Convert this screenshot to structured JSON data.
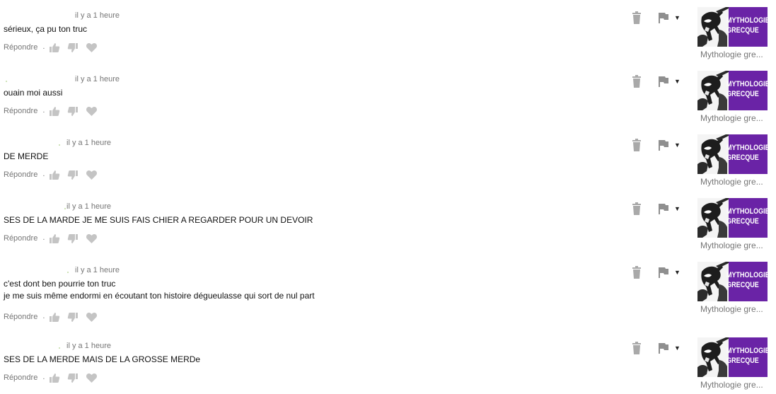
{
  "icons": {
    "like": "thumb-up-icon",
    "dislike": "thumb-down-icon",
    "heart": "heart-icon",
    "delete": "trash-icon",
    "report": "flag-icon",
    "menu": "caret-down-icon"
  },
  "colors": {
    "thumbnail_bg": "#6a23a6",
    "meta_text": "#767676",
    "icon_gray": "#b8b8b8"
  },
  "comments": [
    {
      "timestamp": "il y a 1 heure",
      "lines": [
        "sérieux, ça pu ton truc"
      ],
      "reply_label": "Répondre",
      "dot": ".",
      "video": {
        "thumb_title_1": "MYTHOLOGIE",
        "thumb_title_2": "GRECQUE",
        "title": "Mythologie gre..."
      }
    },
    {
      "timestamp": "il y a 1 heure",
      "lines": [
        "ouain moi aussi"
      ],
      "reply_label": "Répondre",
      "dot": ".",
      "video": {
        "thumb_title_1": "MYTHOLOGIE",
        "thumb_title_2": "GRECQUE",
        "title": "Mythologie gre..."
      }
    },
    {
      "timestamp": "il y a 1 heure",
      "lines": [
        "DE MERDE"
      ],
      "reply_label": "Répondre",
      "dot": ".",
      "video": {
        "thumb_title_1": "MYTHOLOGIE",
        "thumb_title_2": "GRECQUE",
        "title": "Mythologie gre..."
      }
    },
    {
      "timestamp": "il y a 1 heure",
      "lines": [
        "SES DE LA MARDE JE ME SUIS FAIS CHIER A REGARDER POUR UN DEVOIR"
      ],
      "reply_label": "Répondre",
      "dot": ".",
      "video": {
        "thumb_title_1": "MYTHOLOGIE",
        "thumb_title_2": "GRECQUE",
        "title": "Mythologie gre..."
      }
    },
    {
      "timestamp": "il y a 1 heure",
      "lines": [
        "c'est dont ben pourrie ton truc",
        "je me suis même endormi en écoutant ton histoire dégueulasse qui sort de nul part"
      ],
      "reply_label": "Répondre",
      "dot": ".",
      "video": {
        "thumb_title_1": "MYTHOLOGIE",
        "thumb_title_2": "GRECQUE",
        "title": "Mythologie gre..."
      }
    },
    {
      "timestamp": "il y a 1 heure",
      "lines": [
        "SES DE LA MERDE MAIS DE LA GROSSE MERDe"
      ],
      "reply_label": "Répondre",
      "dot": ".",
      "video": {
        "thumb_title_1": "MYTHOLOGIE",
        "thumb_title_2": "GRECQUE",
        "title": "Mythologie gre..."
      }
    }
  ]
}
